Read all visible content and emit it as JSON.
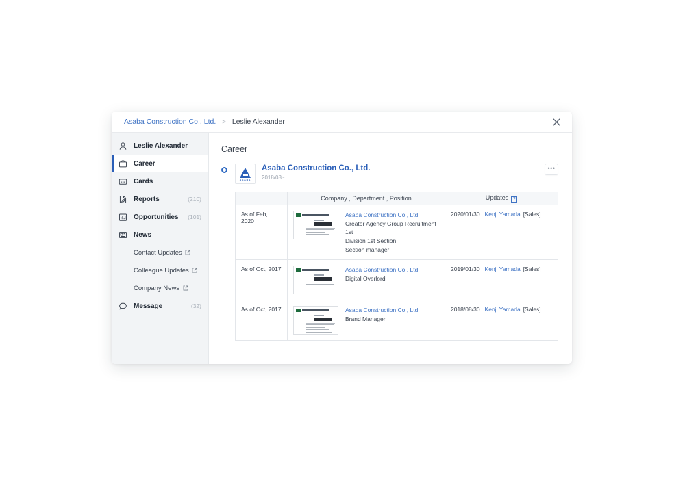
{
  "breadcrumb": {
    "company": "Asaba Construction Co., Ltd.",
    "separator": ">",
    "person": "Leslie Alexander"
  },
  "close_label": "×",
  "sidebar": {
    "items": [
      {
        "label": "Leslie Alexander",
        "icon": "person-icon",
        "count": ""
      },
      {
        "label": "Career",
        "icon": "briefcase-icon",
        "count": ""
      },
      {
        "label": "Cards",
        "icon": "id-card-icon",
        "count": ""
      },
      {
        "label": "Reports",
        "icon": "report-icon",
        "count": "(210)"
      },
      {
        "label": "Opportunities",
        "icon": "bar-chart-icon",
        "count": "(101)"
      },
      {
        "label": "News",
        "icon": "news-icon",
        "count": ""
      }
    ],
    "subitems": [
      {
        "label": "Contact Updates",
        "icon": "external-link-icon"
      },
      {
        "label": "Colleague Updates",
        "icon": "external-link-icon"
      },
      {
        "label": "Company News",
        "icon": "external-link-icon"
      }
    ],
    "message": {
      "label": "Message",
      "icon": "speech-bubble-icon",
      "count": "(32)"
    }
  },
  "main": {
    "section_title": "Career",
    "entry": {
      "company_name": "Asaba Construction Co., Ltd.",
      "period": "2018/08~",
      "logo_text": "ASABA",
      "more_label": "•••"
    },
    "table": {
      "headers": {
        "date": "",
        "info": "Company , Department , Position",
        "updates": "Updates",
        "updates_help": "?"
      },
      "rows": [
        {
          "date": "As of Feb, 2020",
          "company": "Asaba Construction Co., Ltd.",
          "position_lines": [
            "Creator Agency Group Recruitment 1st",
            "Division 1st Section",
            "Section manager"
          ],
          "update_date": "2020/01/30",
          "update_user": "Kenji Yamada",
          "update_dept": "[Sales]"
        },
        {
          "date": "As of Oct, 2017",
          "company": "Asaba Construction Co., Ltd.",
          "position_lines": [
            "Digital Overlord"
          ],
          "update_date": "2019/01/30",
          "update_user": "Kenji Yamada",
          "update_dept": "[Sales]"
        },
        {
          "date": "As of Oct, 2017",
          "company": "Asaba Construction Co., Ltd.",
          "position_lines": [
            "Brand Manager"
          ],
          "update_date": "2018/08/30",
          "update_user": "Kenji Yamada",
          "update_dept": "[Sales]"
        }
      ]
    }
  },
  "colors": {
    "accent": "#2b5fb8",
    "link": "#3f73c4",
    "sidebar_bg": "#f2f4f6",
    "border": "#e3e6ea",
    "text": "#3c4450",
    "muted": "#9aa2ad"
  }
}
